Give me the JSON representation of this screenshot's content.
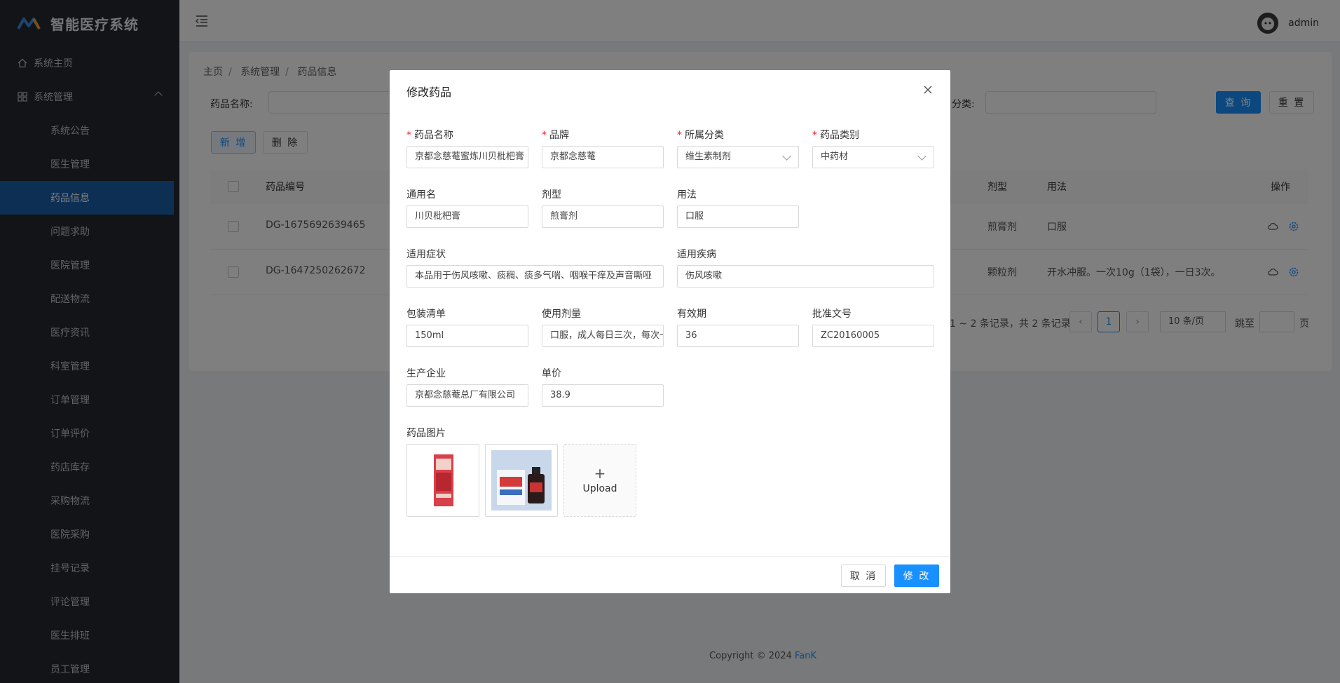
{
  "app": {
    "title": "智能医疗系统"
  },
  "sidebar": {
    "home": "系统主页",
    "group": "系统管理",
    "items": [
      {
        "label": "系统公告"
      },
      {
        "label": "医生管理"
      },
      {
        "label": "药品信息",
        "active": true
      },
      {
        "label": "问题求助"
      },
      {
        "label": "医院管理"
      },
      {
        "label": "配送物流"
      },
      {
        "label": "医疗资讯"
      },
      {
        "label": "科室管理"
      },
      {
        "label": "订单管理"
      },
      {
        "label": "订单评价"
      },
      {
        "label": "药店库存"
      },
      {
        "label": "采购物流"
      },
      {
        "label": "医院采购"
      },
      {
        "label": "挂号记录"
      },
      {
        "label": "评论管理"
      },
      {
        "label": "医生排班"
      },
      {
        "label": "员工管理"
      }
    ]
  },
  "header": {
    "username": "admin"
  },
  "breadcrumb": [
    "主页",
    "系统管理",
    "药品信息"
  ],
  "search": {
    "name_label": "药品名称:",
    "category_label": "分类:",
    "query_btn": "查 询",
    "reset_btn": "重 置"
  },
  "actions": {
    "add_btn": "新 增",
    "delete_btn": "删 除"
  },
  "table": {
    "headers": {
      "code": "药品编号",
      "dosage_form": "剂型",
      "usage": "用法",
      "ops": "操作"
    },
    "rows": [
      {
        "code": "DG-1675692639465",
        "dosage_form": "煎膏剂",
        "usage": "口服"
      },
      {
        "code": "DG-1647250262672",
        "dosage_form": "颗粒剂",
        "usage": "开水冲服。一次10g（1袋），一日3次。"
      }
    ]
  },
  "pager": {
    "summary": "1 ~ 2 条记录，共 2 条记录",
    "current": "1",
    "page_size": "10 条/页",
    "jump_label": "跳至",
    "page_suffix": "页"
  },
  "footer": {
    "copyright": "Copyright © 2024",
    "author": "FanK"
  },
  "modal": {
    "title": "修改药品",
    "fields": {
      "name": {
        "label": "药品名称",
        "value": "京都念慈菴蜜炼川贝枇杷膏"
      },
      "brand": {
        "label": "品牌",
        "value": "京都念慈菴"
      },
      "category": {
        "label": "所属分类",
        "value": "维生素制剂"
      },
      "type": {
        "label": "药品类别",
        "value": "中药材"
      },
      "generic_name": {
        "label": "通用名",
        "value": "川贝枇杷膏"
      },
      "dosage_form": {
        "label": "剂型",
        "value": "煎膏剂"
      },
      "usage": {
        "label": "用法",
        "value": "口服"
      },
      "indications": {
        "label": "适用症状",
        "value": "本品用于伤风咳嗽、痰稠、痰多气喘、咽喉干痒及声音嘶哑"
      },
      "disease": {
        "label": "适用疾病",
        "value": "伤风咳嗽"
      },
      "package": {
        "label": "包装清单",
        "value": "150ml"
      },
      "dosage": {
        "label": "使用剂量",
        "value": "口服，成人每日三次，每次一汤匙"
      },
      "validity": {
        "label": "有效期",
        "value": "36"
      },
      "approval": {
        "label": "批准文号",
        "value": "ZC20160005"
      },
      "manufacturer": {
        "label": "生产企业",
        "value": "京都念慈菴总厂有限公司"
      },
      "price": {
        "label": "单价",
        "value": "38.9"
      }
    },
    "images_label": "药品图片",
    "upload_label": "Upload",
    "cancel_btn": "取 消",
    "submit_btn": "修 改"
  },
  "colors": {
    "primary": "#1890ff",
    "sidebar": "#242830",
    "active": "#1c5ea8",
    "required": "#f5222d"
  }
}
